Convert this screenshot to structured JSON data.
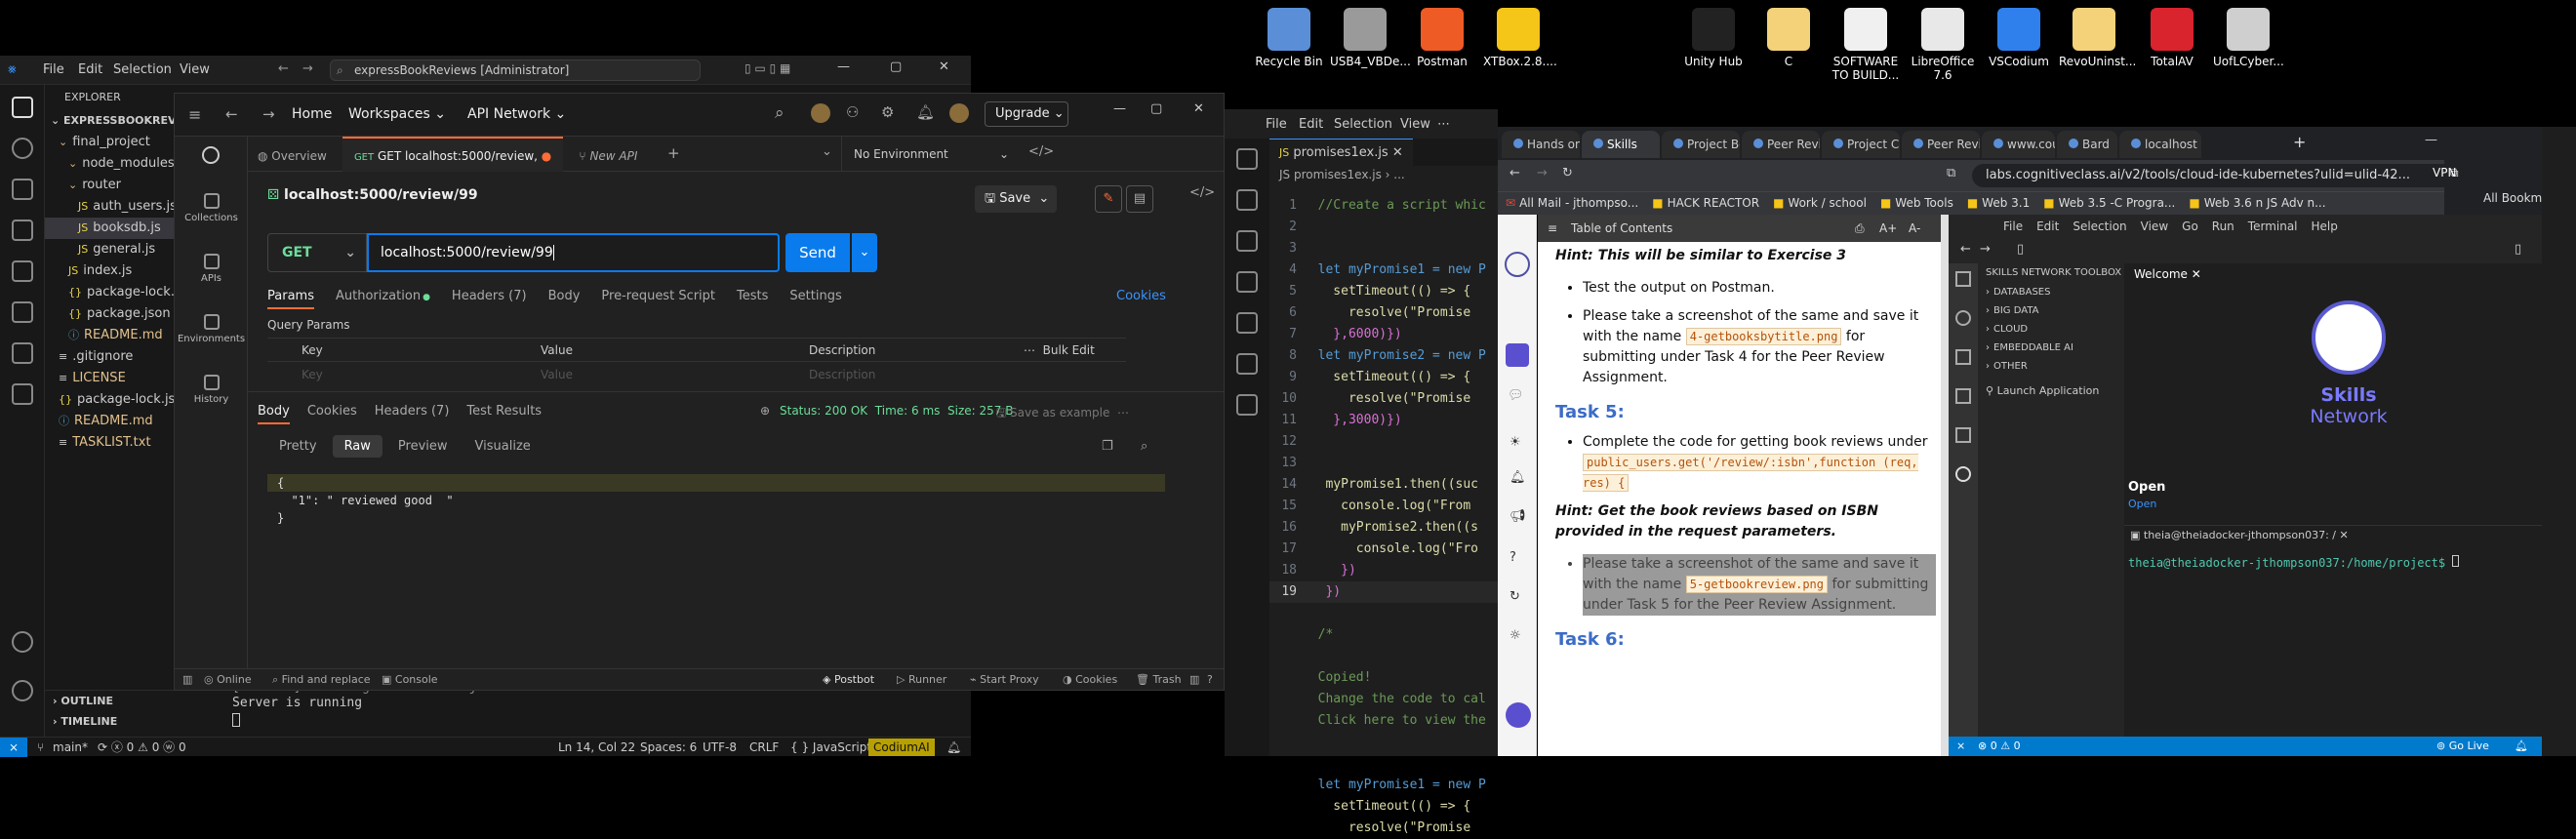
{
  "desktop": {
    "icons": [
      {
        "label": "Recycle Bin",
        "color": "#5a8fd8"
      },
      {
        "label": "USB4_VBDe...",
        "color": "#9a9a9a"
      },
      {
        "label": "Postman",
        "color": "#ef5b25"
      },
      {
        "label": "XTBox.2.8....",
        "color": "#f5c518"
      },
      {
        "label": "Unity Hub",
        "color": "#222222"
      },
      {
        "label": "C",
        "color": "#f3d27a"
      },
      {
        "label": "SOFTWARE TO BUILD...",
        "color": "#f0f0f0"
      },
      {
        "label": "LibreOffice 7.6",
        "color": "#e8e8e8"
      },
      {
        "label": "VSCodium",
        "color": "#2f80ed"
      },
      {
        "label": "RevoUninst...",
        "color": "#f3d27a"
      },
      {
        "label": "TotalAV",
        "color": "#d9232d"
      },
      {
        "label": "UofLCyber...",
        "color": "#cfcfcf"
      }
    ]
  },
  "vscode_left": {
    "menu": [
      "File",
      "Edit",
      "Selection",
      "View"
    ],
    "search": "expressBookReviews [Administrator]",
    "explorer_title": "EXPLORER",
    "root": "EXPRESSBOOKREVIEW",
    "tree": [
      {
        "label": "final_project",
        "indent": 1,
        "type": "folder"
      },
      {
        "label": "node_modules",
        "indent": 2,
        "type": "folder"
      },
      {
        "label": "router",
        "indent": 2,
        "type": "folder"
      },
      {
        "label": "auth_users.js",
        "indent": 3,
        "type": "js"
      },
      {
        "label": "booksdb.js",
        "indent": 3,
        "type": "js"
      },
      {
        "label": "general.js",
        "indent": 3,
        "type": "js"
      },
      {
        "label": "index.js",
        "indent": 2,
        "type": "js"
      },
      {
        "label": "package-lock.js",
        "indent": 2,
        "type": "json"
      },
      {
        "label": "package.json",
        "indent": 2,
        "type": "json"
      },
      {
        "label": "README.md",
        "indent": 2,
        "type": "md"
      },
      {
        "label": ".gitignore",
        "indent": 1,
        "type": "other"
      },
      {
        "label": "LICENSE",
        "indent": 1,
        "type": "other"
      },
      {
        "label": "package-lock.js",
        "indent": 1,
        "type": "json"
      },
      {
        "label": "README.md",
        "indent": 1,
        "type": "md"
      },
      {
        "label": "TASKLIST.txt",
        "indent": 1,
        "type": "txt"
      }
    ],
    "outline": "OUTLINE",
    "timeline": "TIMELINE",
    "terminal": [
      "[nodemon] starting `node index.js`",
      "Server is running"
    ],
    "status": {
      "branch": "main*",
      "sync": "⟳ ⓧ 0 ⚠ 0 ⓦ 0",
      "position": "Ln 14, Col 22",
      "spaces": "Spaces: 6",
      "encoding": "UTF-8",
      "eol": "CRLF",
      "lang": "{ } JavaScript",
      "ext": "CodiumAI"
    }
  },
  "postman": {
    "home": "Home",
    "workspaces": "Workspaces ⌄",
    "api_network": "API Network ⌄",
    "upgrade": "Upgrade",
    "left_nav": [
      "Collections",
      "APIs",
      "Environments",
      "History"
    ],
    "tabs": [
      "Overview",
      "GET localhost:5000/review,",
      "New API"
    ],
    "environment": "No Environment",
    "request_title": "localhost:5000/review/99",
    "save": "Save",
    "method": "GET",
    "url": "localhost:5000/review/99",
    "send": "Send",
    "req_tabs": [
      "Params",
      "Authorization",
      "Headers (7)",
      "Body",
      "Pre-request Script",
      "Tests",
      "Settings"
    ],
    "cookies": "Cookies",
    "query_params": "Query Params",
    "cols": [
      "Key",
      "Value",
      "Description"
    ],
    "bulk_edit": "Bulk Edit",
    "placeholders": [
      "Key",
      "Value",
      "Description"
    ],
    "resp_tabs": [
      "Body",
      "Cookies",
      "Headers (7)",
      "Test Results"
    ],
    "status": "Status: 200 OK",
    "time": "Time: 6 ms",
    "size": "Size: 257 B",
    "save_example": "Save as example",
    "view_tabs": [
      "Pretty",
      "Raw",
      "Preview",
      "Visualize"
    ],
    "response": [
      "{",
      "  \"1\": \" reviewed good  \"",
      "}"
    ],
    "footer": [
      "Online",
      "Find and replace",
      "Console",
      "Postbot",
      "Runner",
      "Start Proxy",
      "Cookies",
      "Trash"
    ]
  },
  "editor": {
    "menu": [
      "File",
      "Edit",
      "Selection",
      "View"
    ],
    "tab": "promises1ex.js",
    "crumb": "JS promises1ex.js",
    "lines": [
      {
        "n": "1",
        "t": "  //Create a script whic"
      },
      {
        "n": "2",
        "t": ""
      },
      {
        "n": "3",
        "t": ""
      },
      {
        "n": "4",
        "t": "  let myPromise1 = new P"
      },
      {
        "n": "5",
        "t": "    setTimeout(() => {"
      },
      {
        "n": "6",
        "t": "      resolve(\"Promise"
      },
      {
        "n": "7",
        "t": "    },6000)})"
      },
      {
        "n": "8",
        "t": "  let myPromise2 = new P"
      },
      {
        "n": "9",
        "t": "    setTimeout(() => {"
      },
      {
        "n": "10",
        "t": "      resolve(\"Promise"
      },
      {
        "n": "11",
        "t": "    },3000)})"
      },
      {
        "n": "12",
        "t": ""
      },
      {
        "n": "13",
        "t": ""
      },
      {
        "n": "14",
        "t": "   myPromise1.then((suc"
      },
      {
        "n": "15",
        "t": "     console.log(\"From"
      },
      {
        "n": "16",
        "t": "     myPromise2.then((s"
      },
      {
        "n": "17",
        "t": "       console.log(\"Fro"
      },
      {
        "n": "18",
        "t": "     })"
      },
      {
        "n": "19",
        "t": "   })"
      },
      {
        "n": "",
        "t": ""
      },
      {
        "n": "",
        "t": "  /*"
      },
      {
        "n": "",
        "t": ""
      },
      {
        "n": "",
        "t": "  Copied!"
      },
      {
        "n": "",
        "t": "  Change the code to cal"
      },
      {
        "n": "",
        "t": "  Click here to view the"
      },
      {
        "n": "",
        "t": ""
      },
      {
        "n": "",
        "t": ""
      },
      {
        "n": "",
        "t": "  let myPromise1 = new P"
      },
      {
        "n": "",
        "t": "    setTimeout(() => {"
      },
      {
        "n": "",
        "t": "      resolve(\"Promise"
      }
    ]
  },
  "browser": {
    "tabs": [
      "Hands on",
      "Skills",
      "Project Bo",
      "Peer Revi",
      "Project Co",
      "Peer Revi",
      "www.cou",
      "Bard",
      "localhost"
    ],
    "url": "labs.cognitiveclass.ai/v2/tools/cloud-ide-kubernetes?ulid=ulid-42...",
    "vpn": "VPN",
    "bookmarks": [
      "All Mail - jthompso...",
      "HACK REACTOR",
      "Work / school",
      "Web Tools",
      "Web 3.1",
      "Web 3.5 -C Progra...",
      "Web 3.6 n JS Adv n..."
    ],
    "all_bookmarks": "All Bookmarks",
    "toc": "Table of Contents",
    "hint1": "Hint: This will be similar to Exercise 3",
    "bullet1": "Test the output on Postman.",
    "bullet2a": "Please take a screenshot of the same and save it with the name",
    "chip1": "4-getbooksbytitle.png",
    "bullet2b": "for submitting under Task 4 for the Peer Review Assignment.",
    "task5": "Task 5:",
    "bullet3": "Complete the code for getting book reviews under",
    "chip2": "public_users.get('/review/:isbn',function (req, res) {",
    "hint2": "Hint: Get the book reviews based on ISBN provided in the request parameters.",
    "bullet4a": "Please take a screenshot of the same and save it with the name",
    "chip3": "5-getbookreview.png",
    "bullet4b": "for submitting under Task 5 for the Peer Review Assignment.",
    "task6": "Task 6:",
    "ide_menu": [
      "File",
      "Edit",
      "Selection",
      "View",
      "Go",
      "Run",
      "Terminal",
      "Help"
    ],
    "toolbox": "SKILLS NETWORK TOOLBOX",
    "toolbox_items": [
      "DATABASES",
      "BIG DATA",
      "CLOUD",
      "EMBEDDABLE AI",
      "OTHER"
    ],
    "launch": "Launch Application",
    "welcome": "Welcome",
    "skills1": "Skills",
    "skills2": "Network",
    "open": "Open",
    "open_link": "Open",
    "term_tab": "theia@theiadocker-jthompson037: /",
    "prompt": "theia@theiadocker-jthompson037:/home/project$",
    "go_live": "Go Live",
    "status_counts": "⊗ 0 ⚠ 0"
  }
}
